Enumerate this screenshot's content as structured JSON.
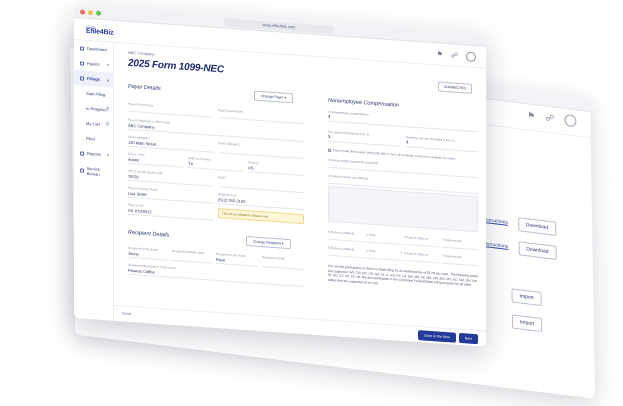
{
  "browser": {
    "url": "www.efile4biz.com"
  },
  "header": {
    "logo_top": "efile4biz",
    "logo_main": "Efile4Biz"
  },
  "sidebar": {
    "items": [
      {
        "label": "Dashboard"
      },
      {
        "label": "Payers"
      },
      {
        "label": "Filings"
      },
      {
        "label": "Start Filing"
      },
      {
        "label": "In Progress",
        "badge": "3"
      },
      {
        "label": "My Cart",
        "badge": "1"
      },
      {
        "label": "Filed"
      },
      {
        "label": "Reports"
      },
      {
        "label": "Service Bureau"
      }
    ]
  },
  "form": {
    "company": "ABC Company",
    "title": "2025 Form 1099-NEC",
    "corrected_label": "CORRECTED",
    "payer_section_title": "Payer Details",
    "change_payer_label": "Change Payer",
    "payer_first_name_label": "Payer's First Name",
    "payer_last_name_label": "Payer's Last Name",
    "payer_business_label": "Payer's Business or DBA Name",
    "payer_business_value": "ABC Company",
    "street1_label": "Street address 1",
    "street1_value": "130 Main Street",
    "street2_label": "Street address 2",
    "city_label": "City or Town",
    "city_value": "Austin",
    "state_label": "State or province",
    "state_value": "TX",
    "country_label": "Country",
    "country_value": "US",
    "zip_label": "ZIP or foreign postal code",
    "zip_value": "78701",
    "email_label": "Email",
    "contact_label": "Payer's Contact Name",
    "contact_value": "Lisa Smith",
    "phone_label": "Telephone no.",
    "phone_value": "(512) 555-2155",
    "tin_label": "Payer's TIN",
    "tin_value": "XX-XXX0012",
    "tin_warning": "TIN not yet validated. Validate now",
    "recipient_section_title": "Recipient Details",
    "change_recipient_label": "Change Recipient",
    "recipient_first_label": "Recipient's First Name",
    "recipient_first_value": "Jenny",
    "recipient_middle_label": "Recipient's Middle Initial",
    "recipient_last_label": "Recipient's Last Name",
    "recipient_last_value": "Rose",
    "recipient_suffix_label": "Recipient's Suffix",
    "recipient_business_label": "Recipient's Business or Trade Name",
    "recipient_business_value": "Flowers Coffee"
  },
  "compensation": {
    "title": "Nonemployee Compensation",
    "box1_label": "1 Nonemployee compensation",
    "box1_value": "$",
    "tax_withheld_label": "Tax amount (included in box 1)",
    "tax_withheld_value": "$",
    "overtime_label": "Overtime amount (included in box 1)",
    "overtime_value": "$",
    "box2_label": "Payer made direct sales totaling $5,000 or more of consumer products to recipient for resale",
    "box3_label": "3 Excess golden parachute payments",
    "box4_label": "4 Federal income tax withheld",
    "state_tax_label": "5 State tax withheld",
    "state_label": "6 State",
    "payer_state_no_label": "6 Payer's state no.",
    "state_income_label": "7 State income",
    "state_tax2_label": "5 State tax withheld",
    "state2_label": "6 State",
    "payer_state_no2_label": "6 Payer's state no.",
    "state_income2_label": "7 State income",
    "disclaimer": "Our service participates in Direct-to-State filing for an additional fee of $1.00 per state. The following states are supported: AR, CO, DC, DE, GA, HI, IL, KS, KY, LA, MA, ME, MI, MN, MS, MO, MT, NC, NM, OH, OK, RI, SC, UT, VA, VT, WI. We also participate in the Combined Federal/State Filing program for all other states that are supported at no cost."
  },
  "footer": {
    "left_label": "Reset",
    "save_label": "Save & File Now",
    "next_label": "Next"
  },
  "back_window": {
    "rows": [
      {
        "link": "Instructions",
        "button": "Download"
      },
      {
        "link": "Instructions",
        "button": "Download"
      },
      {
        "link": "",
        "button": "Import"
      },
      {
        "link": "",
        "button": "Import"
      }
    ]
  },
  "colors": {
    "brand": "#243a9a",
    "warning_bg": "#fff6d8"
  }
}
